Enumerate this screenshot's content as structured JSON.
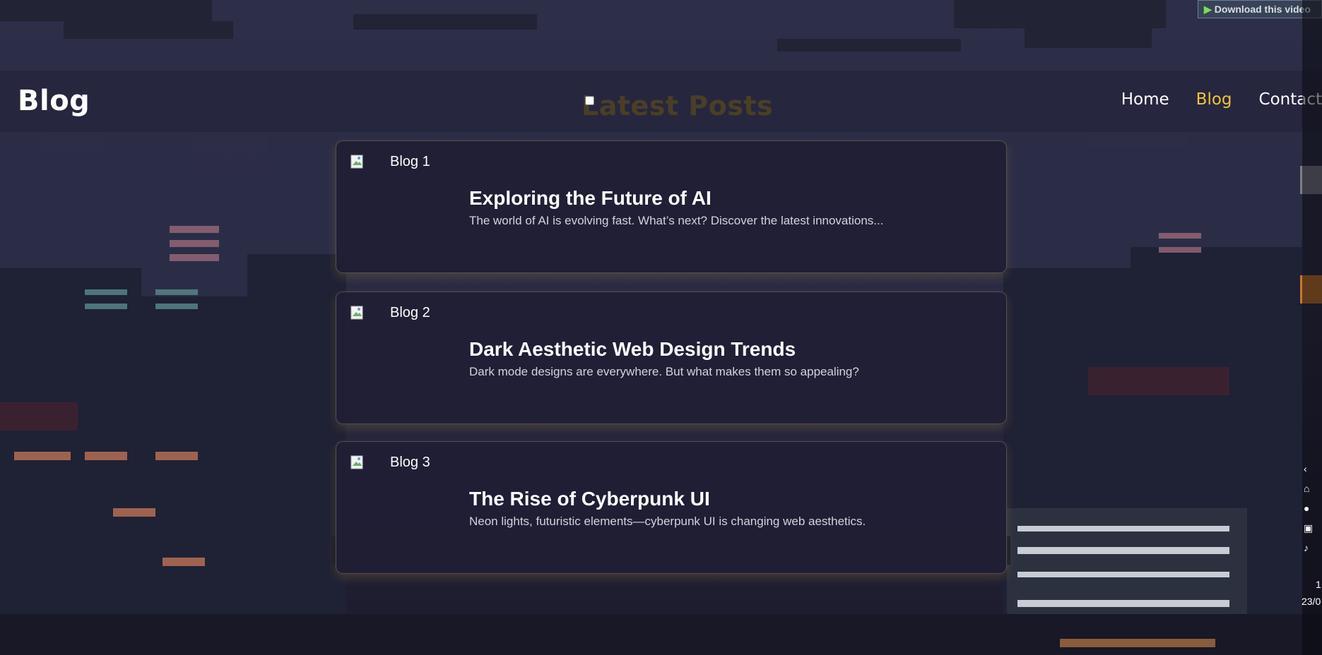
{
  "header": {
    "brand": "Blog",
    "title": "Latest Posts",
    "nav": [
      {
        "label": "Home",
        "active": false
      },
      {
        "label": "Blog",
        "active": true
      },
      {
        "label": "Contact",
        "active": false
      }
    ]
  },
  "posts": [
    {
      "image_alt": "Blog 1",
      "title": "Exploring the Future of AI",
      "excerpt": "The world of AI is evolving fast. What’s next? Discover the latest innovations..."
    },
    {
      "image_alt": "Blog 2",
      "title": "Dark Aesthetic Web Design Trends",
      "excerpt": "Dark mode designs are everywhere. But what makes them so appealing?"
    },
    {
      "image_alt": "Blog 3",
      "title": "The Rise of Cyberpunk UI",
      "excerpt": "Neon lights, futuristic elements—cyberpunk UI is changing web aesthetics."
    }
  ],
  "overlay": {
    "download_video": "Download this video"
  },
  "taskbar": {
    "time": "1",
    "date": "23/0"
  },
  "colors": {
    "accent": "#f2c33a",
    "card_bg": "#201e34",
    "header_bg": "#26243e"
  },
  "icons": {
    "broken_image": "broken-image-icon",
    "play": "play-icon",
    "chevron": "chevron-left-icon",
    "speaker": "speaker-icon"
  }
}
